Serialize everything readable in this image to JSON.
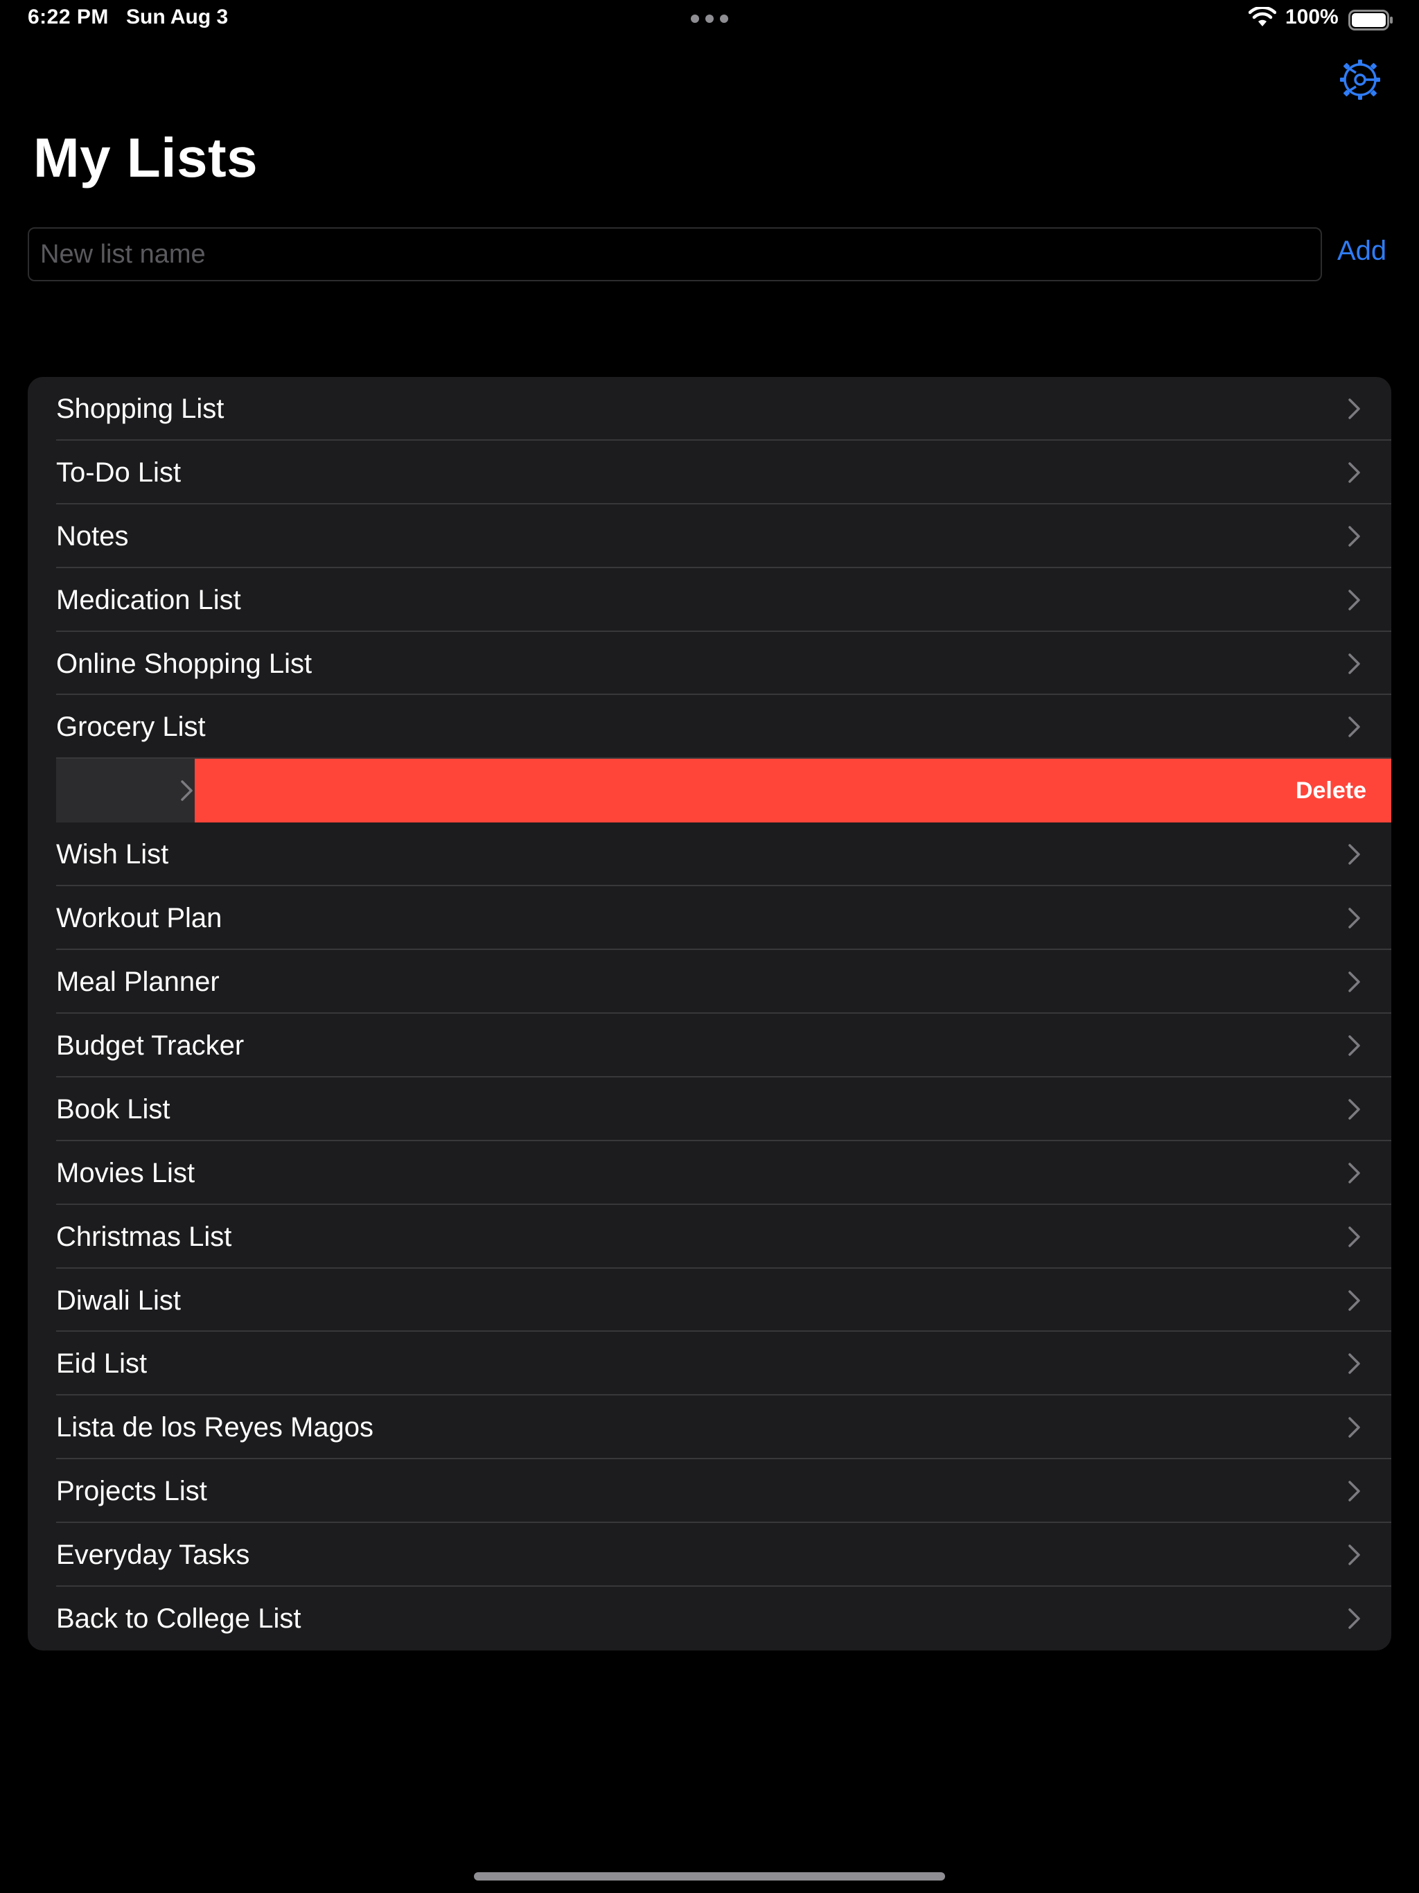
{
  "status_bar": {
    "time": "6:22 PM",
    "date": "Sun Aug 3",
    "battery": "100%"
  },
  "header": {
    "title": "My Lists",
    "settings_icon": "gear-icon"
  },
  "new_list": {
    "placeholder": "New list name",
    "value": "",
    "add_label": "Add"
  },
  "lists": {
    "items_before_swipe": [
      {
        "label": "Shopping List"
      },
      {
        "label": "To-Do List"
      },
      {
        "label": "Notes"
      },
      {
        "label": "Medication List"
      },
      {
        "label": "Online Shopping List"
      },
      {
        "label": "Grocery List"
      }
    ],
    "swiped_row": {
      "delete_label": "Delete"
    },
    "items_after_swipe": [
      {
        "label": "Wish List"
      },
      {
        "label": "Workout Plan"
      },
      {
        "label": "Meal Planner"
      },
      {
        "label": "Budget Tracker"
      },
      {
        "label": "Book List"
      },
      {
        "label": "Movies List"
      },
      {
        "label": "Christmas List"
      },
      {
        "label": "Diwali List"
      },
      {
        "label": "Eid List"
      },
      {
        "label": "Lista de los Reyes Magos"
      },
      {
        "label": "Projects List"
      },
      {
        "label": "Everyday Tasks"
      },
      {
        "label": "Back to College List"
      }
    ]
  },
  "colors": {
    "accent": "#2f7cf6",
    "destructive": "#ff453a",
    "background": "#000000",
    "card": "#1c1c1e"
  }
}
